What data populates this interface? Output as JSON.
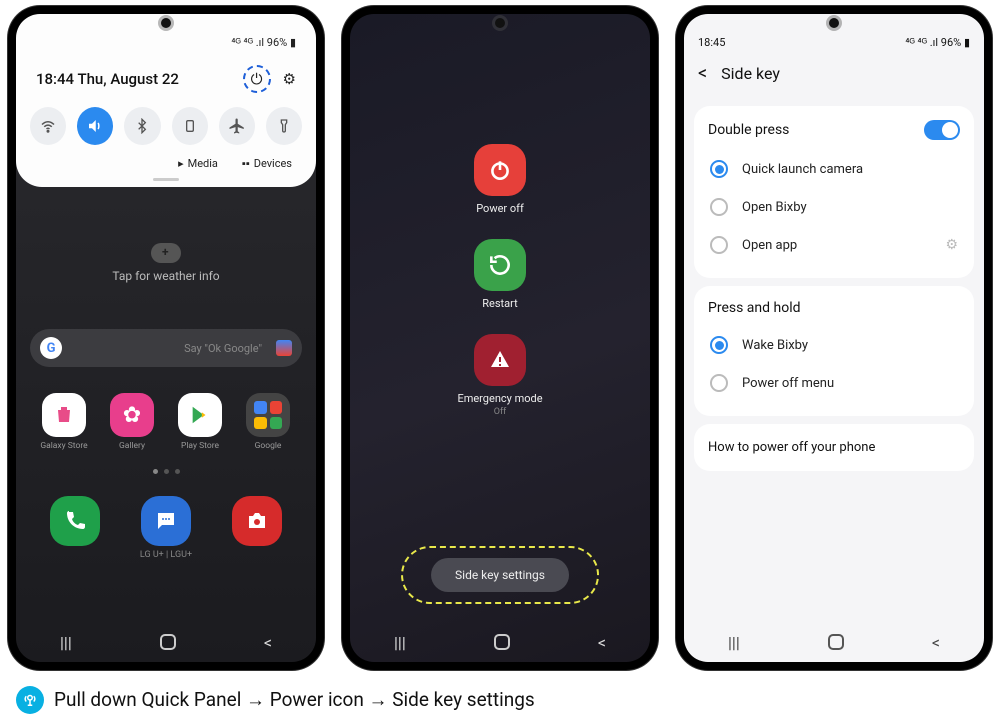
{
  "phone1": {
    "status": "⁴ᴳ ⁴ᴳ .ıl 96% ▮",
    "datetime": "18:44  Thu, August 22",
    "toggles": [
      "wifi",
      "sound",
      "bluetooth",
      "rotation",
      "airplane",
      "flashlight"
    ],
    "media": "Media",
    "devices": "Devices",
    "weather": "Tap for weather info",
    "search_hint": "Say \"Ok Google\"",
    "apps": [
      {
        "label": "Galaxy Store",
        "color": "#fff"
      },
      {
        "label": "Gallery",
        "color": "#e83e8c"
      },
      {
        "label": "Play Store",
        "color": "#fff"
      },
      {
        "label": "Google",
        "color": "#fff"
      }
    ],
    "carrier": "LG U+ | LGU+"
  },
  "phone2": {
    "power_off": "Power off",
    "restart": "Restart",
    "emergency": "Emergency mode",
    "emergency_sub": "Off",
    "side_key": "Side key settings"
  },
  "phone3": {
    "time": "18:45",
    "status": "⁴ᴳ ⁴ᴳ .ıl 96% ▮",
    "title": "Side key",
    "section1": "Double press",
    "opt1": "Quick launch camera",
    "opt2": "Open Bixby",
    "opt3": "Open app",
    "section2": "Press and hold",
    "opt4": "Wake Bixby",
    "opt5": "Power off menu",
    "link": "How to power off your phone"
  },
  "caption": "Pull down Quick Panel → Power icon → Side key settings"
}
